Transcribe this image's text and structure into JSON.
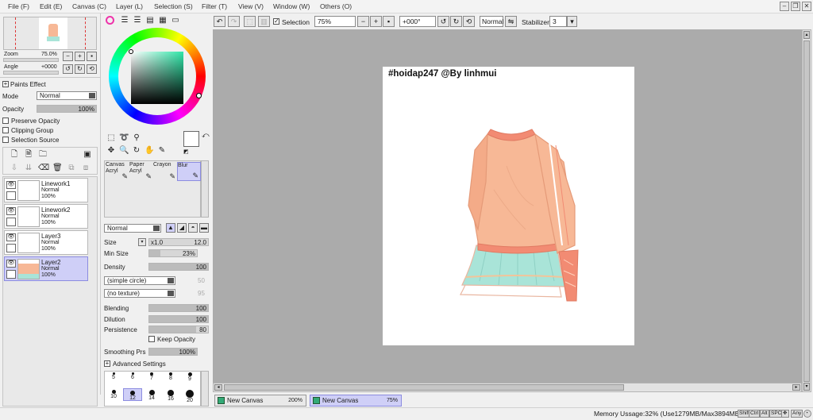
{
  "menu": {
    "items": [
      "File (F)",
      "Edit (E)",
      "Canvas (C)",
      "Layer (L)",
      "Selection (S)",
      "Filter (T)",
      "View (V)",
      "Window (W)",
      "Others (O)"
    ]
  },
  "navigator": {
    "zoom_label": "Zoom",
    "zoom_value": "75.0%",
    "angle_label": "Angle",
    "angle_value": "+0000"
  },
  "paints_effect": {
    "header": "Paints Effect",
    "mode_label": "Mode",
    "mode_value": "Normal",
    "opacity_label": "Opacity",
    "opacity_value": "100%",
    "opacity_fraction": 1.0,
    "preserve_opacity": "Preserve Opacity",
    "clipping_group": "Clipping Group",
    "selection_source": "Selection Source"
  },
  "layers": [
    {
      "name": "Linework1",
      "mode": "Normal",
      "opacity": "100%",
      "selected": false
    },
    {
      "name": "Linework2",
      "mode": "Normal",
      "opacity": "100%",
      "selected": false
    },
    {
      "name": "Layer3",
      "mode": "Normal",
      "opacity": "100%",
      "selected": false
    },
    {
      "name": "Layer2",
      "mode": "Normal",
      "opacity": "100%",
      "selected": true
    }
  ],
  "brushes": [
    {
      "line1": "Canvas",
      "line2": "Acryl",
      "active": false
    },
    {
      "line1": "Paper",
      "line2": "Acryl",
      "active": false
    },
    {
      "line1": "Crayon",
      "line2": "",
      "active": false
    },
    {
      "line1": "Blur",
      "line2": "",
      "active": true
    }
  ],
  "brush_settings": {
    "blend_mode": "Normal",
    "size_label": "Size",
    "size_mult": "x1.0",
    "size_value": "12.0",
    "min_size_label": "Min Size",
    "min_size_value": "23%",
    "density_label": "Density",
    "density_value": "100",
    "shape_value": "(simple circle)",
    "shape_amount": "50",
    "texture_value": "(no texture)",
    "texture_amount": "95",
    "blending_label": "Blending",
    "blending_value": "100",
    "dilution_label": "Dilution",
    "dilution_value": "100",
    "persistence_label": "Persistence",
    "persistence_value": "80",
    "keep_opacity": "Keep Opacity",
    "smoothing_label": "Smoothing Prs",
    "smoothing_value": "100%",
    "advanced": "Advanced Settings"
  },
  "brush_sizes": [
    "5",
    "6",
    "7",
    "8",
    "9",
    "10",
    "12",
    "14",
    "16",
    "20"
  ],
  "toolbar": {
    "selection_label": "Selection",
    "zoom_value": "75%",
    "rotation_value": "+000°",
    "blend_value": "Normal",
    "stabilizer_label": "Stabilizer",
    "stabilizer_value": "3"
  },
  "canvas": {
    "watermark": "#hoidap247 @By linhmui"
  },
  "tabs": [
    {
      "label": "New Canvas",
      "zoom": "200%",
      "active": false
    },
    {
      "label": "New Canvas",
      "zoom": "75%",
      "active": true
    }
  ],
  "status": {
    "memory": "Memory Ussage:32% (Use1279MB/Max3894MB)",
    "keys": [
      "Shift",
      "Ctrl",
      "Alt",
      "SPC",
      "Any"
    ]
  },
  "colors": {
    "selected_highlight": "#cfcff7",
    "canvas_bg": "#ababab",
    "sweater": "#f7b896",
    "skirt": "#a9e4d8"
  }
}
